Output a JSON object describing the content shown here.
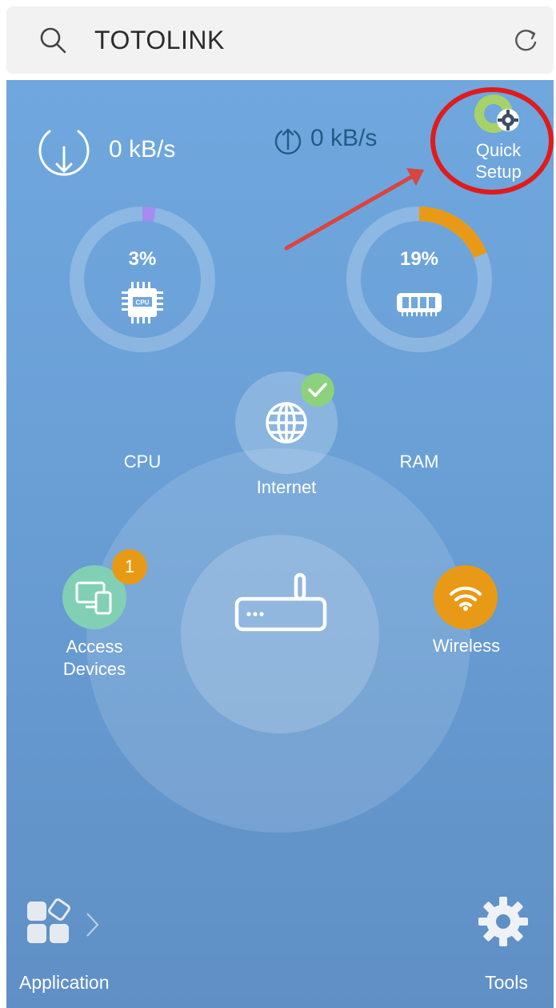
{
  "search": {
    "value": "TOTOLINK",
    "icon": "search-icon",
    "refresh_icon": "refresh-icon"
  },
  "traffic": {
    "download_label": "0 kB/s",
    "upload_label": "0 kB/s"
  },
  "quick_setup": {
    "label_line1": "Quick",
    "label_line2": "Setup",
    "annotation_color": "#e01b1b"
  },
  "gauges": {
    "cpu": {
      "value_label": "3%",
      "percent": 3,
      "label": "CPU",
      "color": "#a58cf0"
    },
    "ram": {
      "value_label": "19%",
      "percent": 19,
      "label": "RAM",
      "color": "#e89a16"
    }
  },
  "nodes": {
    "internet": {
      "label": "Internet",
      "status": "connected"
    },
    "access_devices": {
      "label_line1": "Access",
      "label_line2": "Devices",
      "count": "1"
    },
    "wireless": {
      "label": "Wireless"
    }
  },
  "bottom_nav": {
    "application_label": "Application",
    "tools_label": "Tools"
  },
  "colors": {
    "panel_top": "#6fa7de",
    "panel_bottom": "#5f8fc5",
    "upload_text": "#215c86",
    "badge_orange": "#e89a16",
    "access_green": "#81d0b6",
    "check_green": "#8cd17d"
  }
}
